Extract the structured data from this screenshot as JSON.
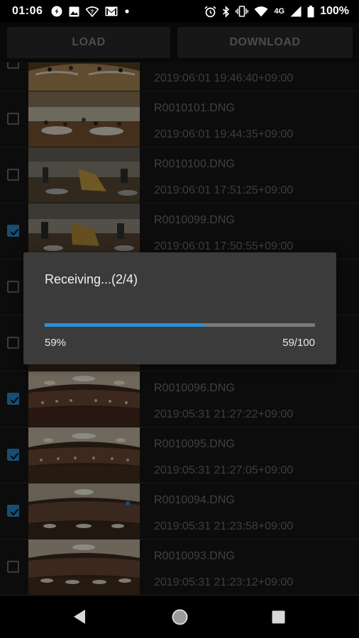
{
  "status_bar": {
    "time": "01:06",
    "left_icons": [
      "edge-icon",
      "image-icon",
      "wifi-question-icon",
      "gmail-icon",
      "dot-icon"
    ],
    "right_icons": [
      "alarm-icon",
      "bluetooth-icon",
      "vibrate-icon",
      "wifi-icon",
      "network-4g-icon",
      "signal-icon",
      "battery-icon"
    ],
    "network": "4G",
    "battery": "100%"
  },
  "toolbar": {
    "load_label": "LOAD",
    "download_label": "DOWNLOAD"
  },
  "files": [
    {
      "name": "",
      "date": "2019:06:01 19:46:40+09:00",
      "checked": false
    },
    {
      "name": "R0010101.DNG",
      "date": "2019:06:01 19:44:35+09:00",
      "checked": false
    },
    {
      "name": "R0010100.DNG",
      "date": "2019:06:01 17:51:25+09:00",
      "checked": false
    },
    {
      "name": "R0010099.DNG",
      "date": "2019:06:01 17:50:55+09:00",
      "checked": true
    },
    {
      "name": "",
      "date": "",
      "checked": false
    },
    {
      "name": "",
      "date": "",
      "checked": false
    },
    {
      "name": "R0010096.DNG",
      "date": "2019:05:31 21:27:22+09:00",
      "checked": true
    },
    {
      "name": "R0010095.DNG",
      "date": "2019:05:31 21:27:05+09:00",
      "checked": true
    },
    {
      "name": "R0010094.DNG",
      "date": "2019:05:31 21:23:58+09:00",
      "checked": true
    },
    {
      "name": "R0010093.DNG",
      "date": "2019:05:31 21:23:12+09:00",
      "checked": false
    }
  ],
  "dialog": {
    "title": "Receiving...(2/4)",
    "progress": 0.59,
    "percent_text": "59%",
    "count_text": "59/100"
  },
  "nav_bar": {
    "buttons": [
      "back-icon",
      "home-icon",
      "recents-icon"
    ]
  },
  "colors": {
    "accent": "#2b8fd6",
    "background": "#161616"
  }
}
